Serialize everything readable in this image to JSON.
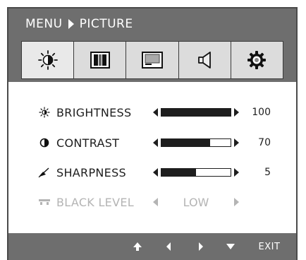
{
  "menu": {
    "breadcrumb_root": "MENU",
    "breadcrumb_current": "PICTURE"
  },
  "tabs": [
    {
      "name": "brightness-tab",
      "icon": "brightness-icon",
      "active": true
    },
    {
      "name": "color-tab",
      "icon": "color-bars-icon",
      "active": false
    },
    {
      "name": "display-tab",
      "icon": "screen-icon",
      "active": false
    },
    {
      "name": "audio-tab",
      "icon": "speaker-icon",
      "active": false
    },
    {
      "name": "setup-tab",
      "icon": "gear-icon",
      "active": false
    }
  ],
  "settings": {
    "brightness": {
      "label": "BRIGHTNESS",
      "value": "100",
      "level": 1.0
    },
    "contrast": {
      "label": "CONTRAST",
      "value": "70",
      "level": 0.7
    },
    "sharpness": {
      "label": "SHARPNESS",
      "value": "5",
      "level": 0.5
    },
    "black_level": {
      "label": "BLACK LEVEL",
      "value": "LOW",
      "enabled": false
    }
  },
  "footer": {
    "exit_label": "EXIT",
    "buttons": [
      "up-arrow-icon",
      "left-arrow-icon",
      "right-arrow-icon",
      "down-arrow-icon"
    ]
  },
  "colors": {
    "header_bg": "#6e6e6e",
    "text": "#1e1e1e",
    "disabled_text": "#b4b4b4"
  }
}
